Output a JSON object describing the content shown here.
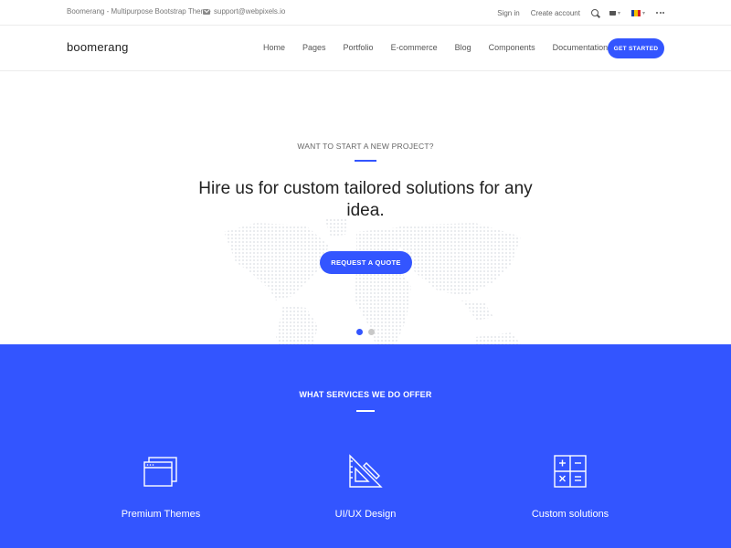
{
  "topbar": {
    "theme_note": "Boomerang - Multipurpose Bootstrap Theme",
    "email": "support@webpixels.io",
    "signin": "Sign in",
    "create_account": "Create account"
  },
  "navbar": {
    "logo": "boomerang",
    "links": [
      "Home",
      "Pages",
      "Portfolio",
      "E-commerce",
      "Blog",
      "Components",
      "Documentation"
    ],
    "cta": "GET STARTED"
  },
  "hero": {
    "eyebrow": "WANT TO START A NEW PROJECT?",
    "headline": "Hire us for custom tailored solutions for any idea.",
    "button": "REQUEST A QUOTE",
    "slides": 2,
    "active_slide": 1
  },
  "services": {
    "title": "WHAT SERVICES WE DO OFFER",
    "items": [
      {
        "label": "Premium Themes",
        "icon": "browser-windows-icon"
      },
      {
        "label": "UI/UX Design",
        "icon": "ruler-triangle-icon"
      },
      {
        "label": "Custom solutions",
        "icon": "calculator-icon"
      }
    ]
  },
  "colors": {
    "accent": "#3355ff",
    "flag_stripes": [
      "#1e3f9c",
      "#f5c400",
      "#d81f26"
    ]
  }
}
